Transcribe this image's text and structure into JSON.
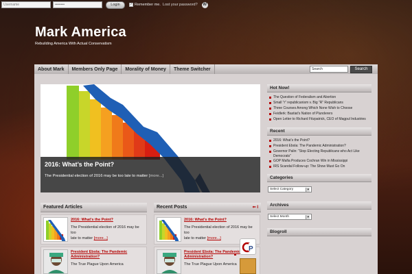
{
  "login": {
    "username_placeholder": "Username",
    "password_value": "••••••••",
    "login_label": "Login",
    "remember_label": "Remember me.",
    "lost_password": "Lost your password?"
  },
  "site": {
    "title": "Mark America",
    "tagline": "Rebuilding America With Actual Conservatism"
  },
  "nav": {
    "items": [
      {
        "label": "About Mark"
      },
      {
        "label": "Members Only Page"
      },
      {
        "label": "Morality of Money"
      },
      {
        "label": "Theme Switcher"
      }
    ],
    "search_value": "Search",
    "search_button": "Search"
  },
  "slider": {
    "title": "2016: What’s the Point?",
    "excerpt": "The Presidential election of 2016 may be too late to matter",
    "more": "[more...]"
  },
  "featured": {
    "heading": "Featured Articles",
    "posts": [
      {
        "title": "2016: What’s the Point?",
        "excerpt1": "The Presidential election of 2016 may be too",
        "excerpt2": "late to matter",
        "more": "[more...]"
      },
      {
        "title": "President Ebola: The Pandemic Administration?",
        "excerpt1": "The True Plague Upon America",
        "excerpt2": "",
        "more": ""
      }
    ]
  },
  "recent_posts": {
    "heading": "Recent Posts",
    "rss": "⇐ I",
    "posts": [
      {
        "title": "2016: What’s the Point?",
        "excerpt1": "The Presidential election of 2016 may be too",
        "excerpt2": "late to matter",
        "more": "[more...]"
      },
      {
        "title": "President Ebola: The Pandemic Administration?",
        "excerpt1": "The True Plague Upon America",
        "excerpt2": "",
        "more": ""
      }
    ]
  },
  "sidebar": {
    "hot_now": {
      "heading": "Hot Now!",
      "items": [
        "The Question of Federalism and Abortion",
        "Small “r” republicanism v. Big “R” Republicans",
        "Three Courses Among Which None Wish to Choose",
        "Feidlerk: Bastiat’s Nation of Plunderers",
        "Open Letter to Richard Fitzpatrick, CEO of Magpul Industries"
      ]
    },
    "recent": {
      "heading": "Recent",
      "items": [
        "2016: What’s the Point?",
        "President Ebola: The Pandemic Administration?",
        "Governor Palin: “Stop Electing Republicans who Act Like Democrats”",
        "GOP Mafia Produces Cochran Win in Mississippi",
        "IRS Scandal Follow-up: The Show Must Go On"
      ]
    },
    "categories": {
      "heading": "Categories",
      "select": "Select Category"
    },
    "archives": {
      "heading": "Archives",
      "select": "Select Month"
    },
    "blogroll": {
      "heading": "Blogroll"
    }
  },
  "colors": {
    "accent_red": "#b30000",
    "nav_bg": "#c8c3c3",
    "panel_bg": "#d8d2d2"
  },
  "icons": {
    "wordpress": "wordpress-icon",
    "rss": "rss-icon"
  }
}
